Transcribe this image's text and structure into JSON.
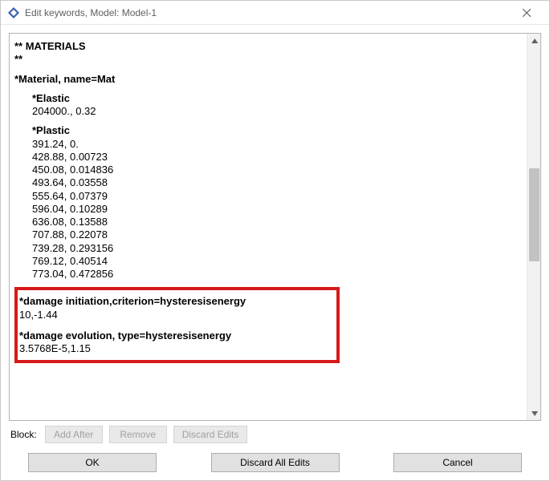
{
  "window": {
    "title": "Edit keywords, Model: Model-1"
  },
  "editor": {
    "header1": "** MATERIALS",
    "header2": "**",
    "material": "*Material, name=Mat",
    "elastic_key": "*Elastic",
    "elastic_data": "204000.,  0.32",
    "plastic_key": "*Plastic",
    "plastic_rows": [
      " 391.24,        0.",
      " 428.88,  0.00723",
      " 450.08, 0.014836",
      " 493.64,  0.03558",
      " 555.64,  0.07379",
      " 596.04,  0.10289",
      " 636.08,  0.13588",
      " 707.88,  0.22078",
      " 739.28, 0.293156",
      " 769.12,  0.40514",
      " 773.04, 0.472856"
    ],
    "damage_init_key": "*damage initiation,criterion=hysteresisenergy",
    "damage_init_data": "10,-1.44",
    "damage_evo_key": "*damage evolution, type=hysteresisenergy",
    "damage_evo_data": "3.5768E-5,1.15"
  },
  "block_row": {
    "label": "Block:",
    "add_after": "Add After",
    "remove": "Remove",
    "discard_edits": "Discard Edits"
  },
  "footer": {
    "ok": "OK",
    "discard_all": "Discard All Edits",
    "cancel": "Cancel"
  }
}
